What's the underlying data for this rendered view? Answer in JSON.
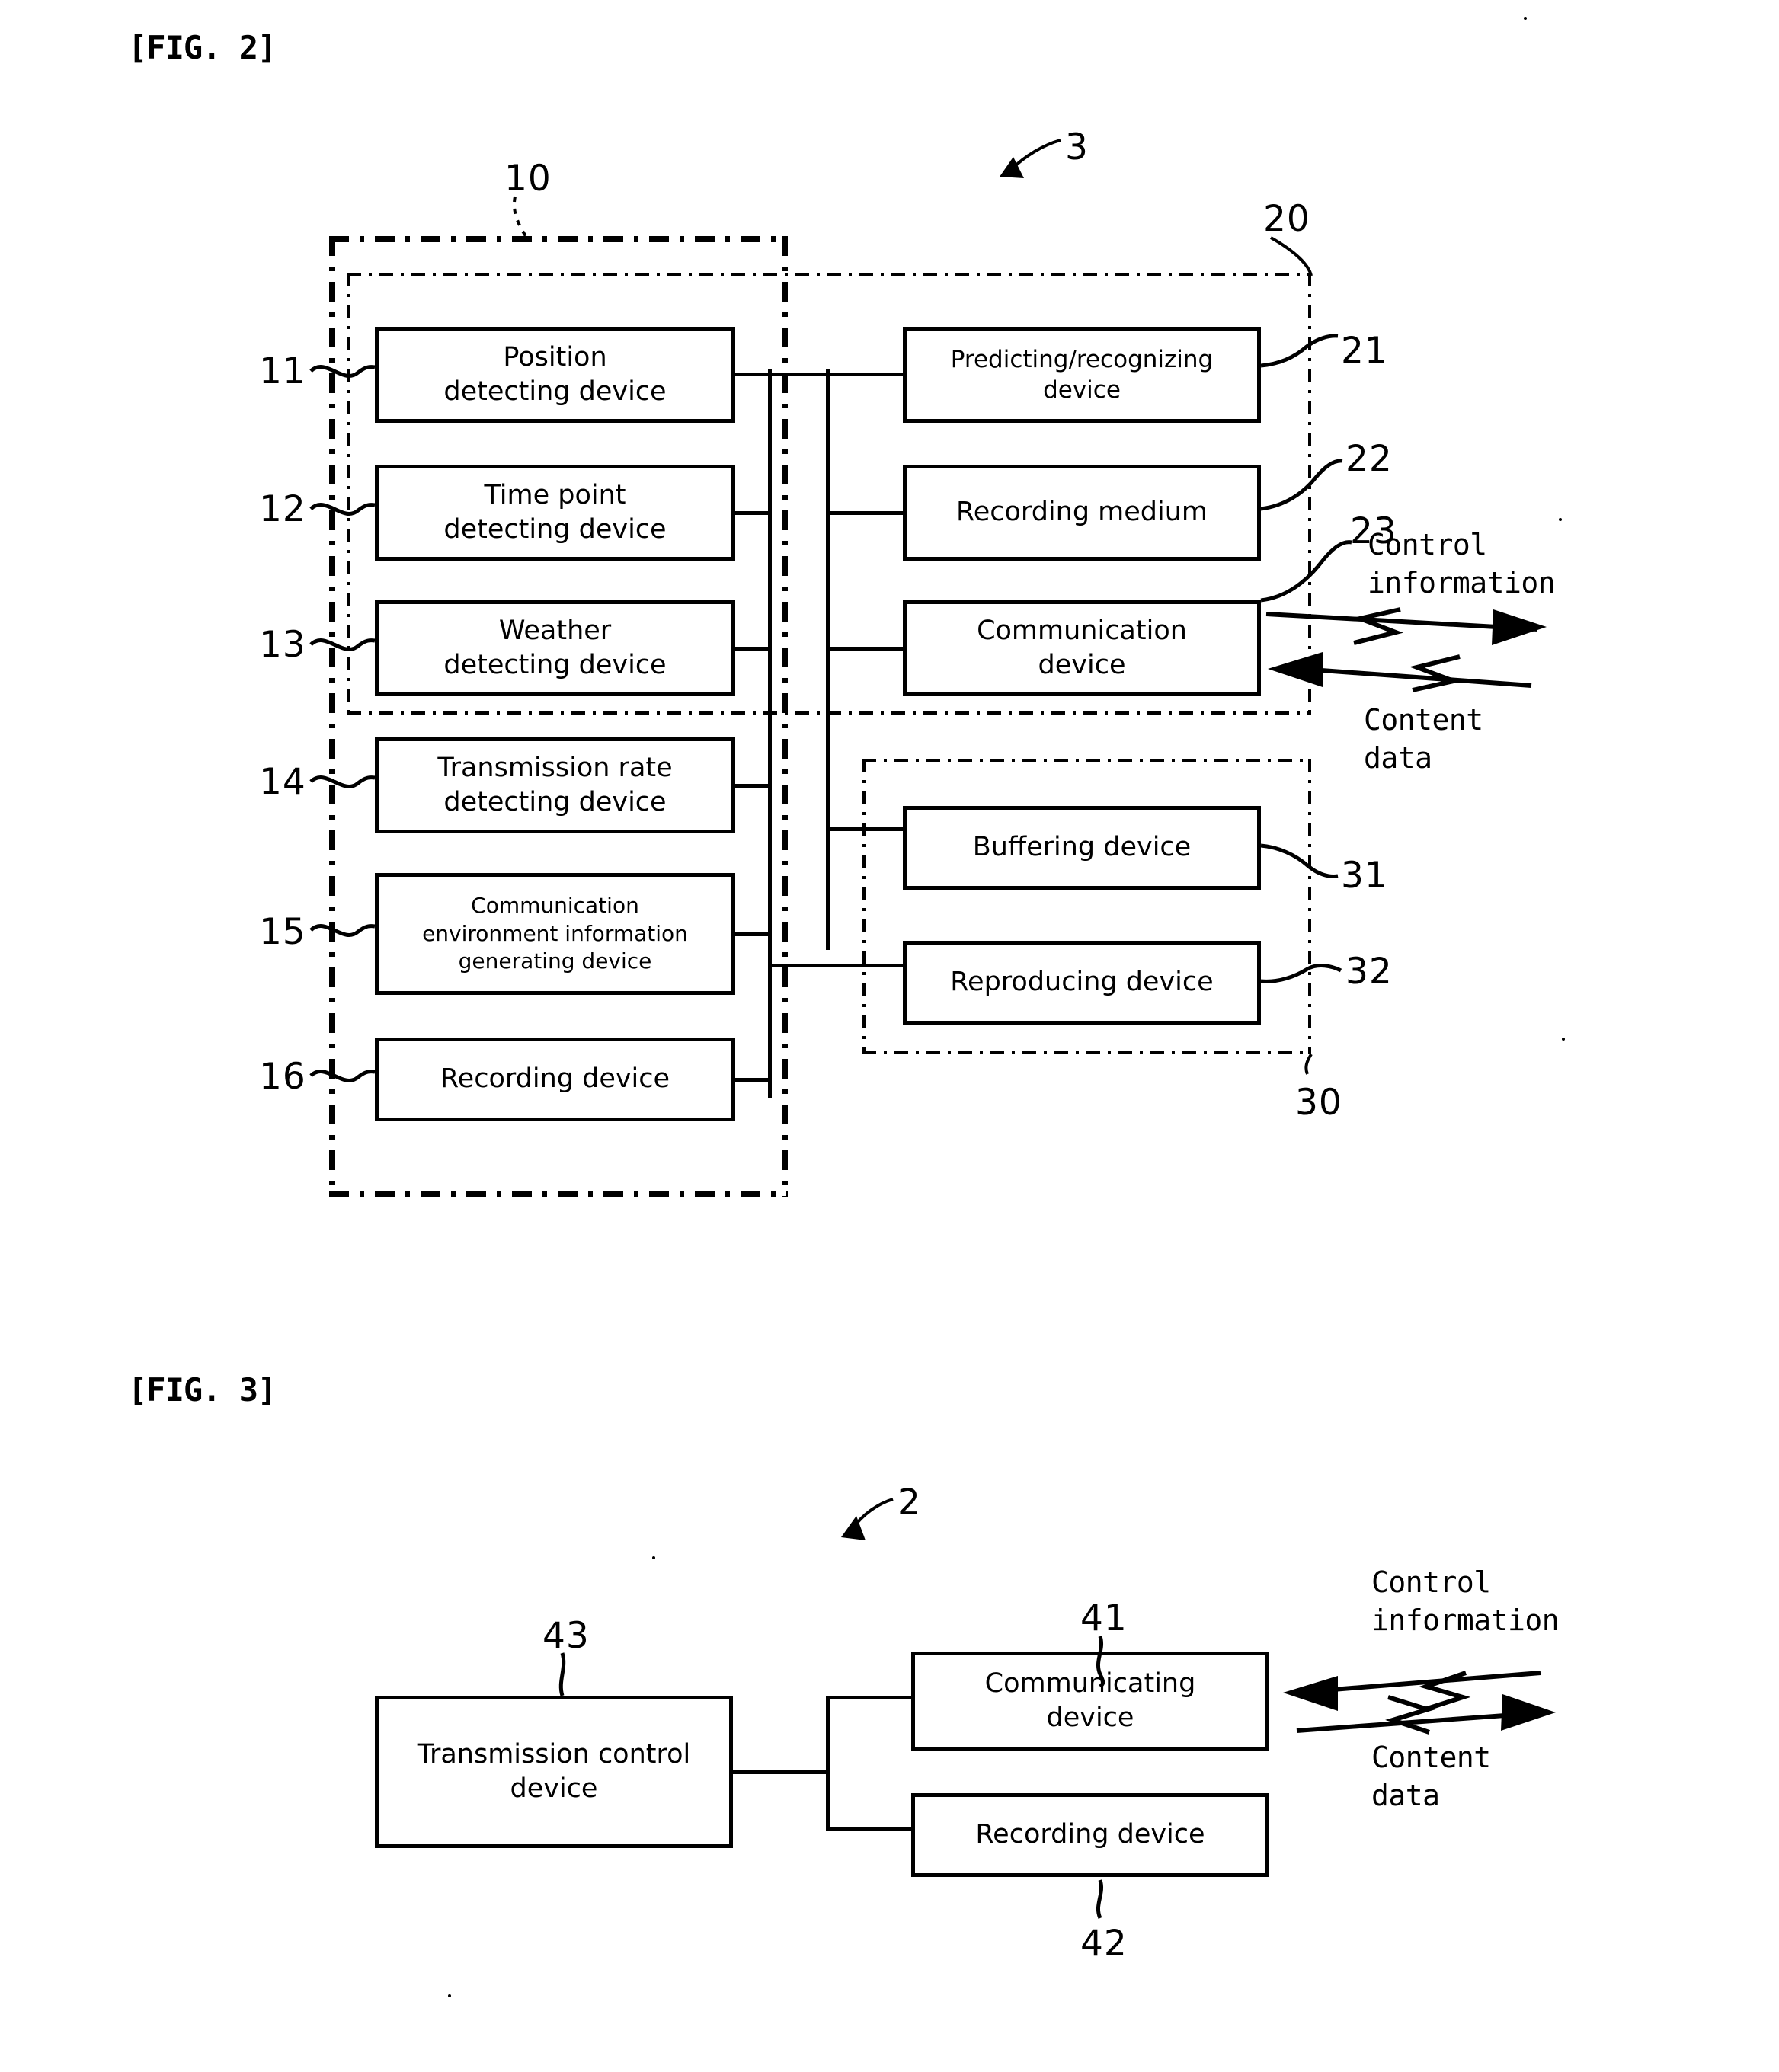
{
  "figures": [
    {
      "title": "[FIG. 2]",
      "system_ref": "3",
      "groups": [
        {
          "ref": "10",
          "name": "detecting-device-group"
        },
        {
          "ref": "20",
          "name": "processing-group"
        },
        {
          "ref": "30",
          "name": "playback-group"
        }
      ],
      "left_boxes": [
        {
          "ref": "11",
          "lines": [
            "Position",
            "detecting device"
          ]
        },
        {
          "ref": "12",
          "lines": [
            "Time point",
            "detecting device"
          ]
        },
        {
          "ref": "13",
          "lines": [
            "Weather",
            "detecting device"
          ]
        },
        {
          "ref": "14",
          "lines": [
            "Transmission rate",
            "detecting device"
          ]
        },
        {
          "ref": "15",
          "lines": [
            "Communication",
            "environment information",
            "generating device"
          ]
        },
        {
          "ref": "16",
          "lines": [
            "Recording device"
          ]
        }
      ],
      "right_boxes": [
        {
          "ref": "21",
          "lines": [
            "Predicting/recognizing",
            "device"
          ]
        },
        {
          "ref": "22",
          "lines": [
            "Recording medium"
          ]
        },
        {
          "ref": "23",
          "lines": [
            "Communication",
            "device"
          ]
        },
        {
          "ref": "31",
          "lines": [
            "Buffering device"
          ]
        },
        {
          "ref": "32",
          "lines": [
            "Reproducing device"
          ]
        }
      ],
      "flows": [
        {
          "label": [
            "Control",
            "information"
          ],
          "direction": "outgoing"
        },
        {
          "label": [
            "Content",
            "data"
          ],
          "direction": "incoming"
        }
      ]
    },
    {
      "title": "[FIG. 3]",
      "system_ref": "2",
      "boxes": [
        {
          "ref": "43",
          "lines": [
            "Transmission control",
            "device"
          ]
        },
        {
          "ref": "41",
          "lines": [
            "Communicating",
            "device"
          ]
        },
        {
          "ref": "42",
          "lines": [
            "Recording device"
          ]
        }
      ],
      "flows": [
        {
          "label": [
            "Control",
            "information"
          ],
          "direction": "incoming"
        },
        {
          "label": [
            "Content",
            "data"
          ],
          "direction": "outgoing"
        }
      ]
    }
  ]
}
